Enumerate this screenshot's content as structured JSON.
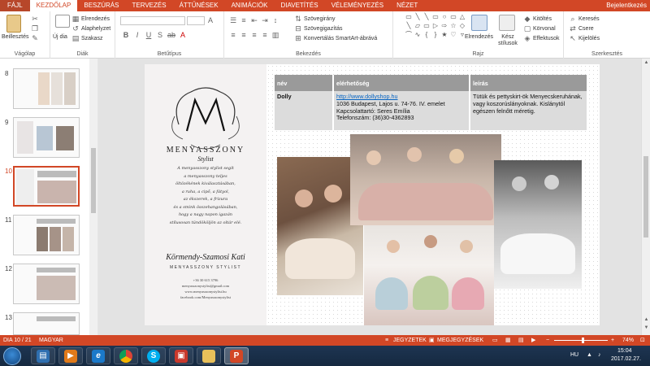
{
  "tabs": [
    "FÁJL",
    "KEZDŐLAP",
    "BESZÚRÁS",
    "TERVEZÉS",
    "ÁTTŰNÉSEK",
    "ANIMÁCIÓK",
    "DIAVETÍTÉS",
    "VÉLEMÉNYEZÉS",
    "NÉZET"
  ],
  "user": "Bejelentkezés",
  "ribbon": {
    "groups": {
      "clipboard": "Vágólap",
      "slides": "Diák",
      "font": "Betűtípus",
      "paragraph": "Bekezdés",
      "drawing": "Rajz",
      "editing": "Szerkesztés"
    },
    "paste": "Beillesztés",
    "new_slide": "Új dia",
    "layout": "Elrendezés",
    "reset": "Alaphelyzet",
    "section": "Szakasz",
    "text_direction": "Szövegirány",
    "align_text": "Szövegigazítás",
    "smartart": "Konvertálás SmartArt-ábrává",
    "arrange": "Elrendezés",
    "quick_styles": "Kész stílusok",
    "fill": "Kitöltés",
    "outline": "Körvonal",
    "effects": "Effektusok",
    "find": "Keresés",
    "replace": "Csere",
    "select": "Kijelölés"
  },
  "thumbnails": [
    {
      "num": "8",
      "selected": false
    },
    {
      "num": "9",
      "selected": false
    },
    {
      "num": "10",
      "selected": true
    },
    {
      "num": "11",
      "selected": false
    },
    {
      "num": "12",
      "selected": false
    },
    {
      "num": "13",
      "selected": false
    }
  ],
  "slide": {
    "logo": "MENYASSZONY",
    "logo_sub": "Stylist",
    "intro": "A menyasszony stylist segít\na menyasszony teljes\nöltözékének kiválasztásában,\na ruha, a cipő, a fátyol,\naz ékszerek, a frizura\nés a smink összehangolásában,\nhogy a nagy napon igazán\nstílusosan tündököljön az oltár elé.",
    "signature": "Körmendy-Szamosi Kati",
    "signature_sub": "MENYASSZONY STYLIST",
    "contact": "+36 30 615 3796\nmenyasszonystylist@gmail.com\nwww.menyasszonystylist.hu\nfacebook.com/Menyasszonystylist",
    "table": {
      "headers": [
        "név",
        "elérhetőség",
        "leírás"
      ],
      "row": {
        "name": "Dolly",
        "link": "http://www.dollyshop.hu",
        "address": "1036 Budapest, Lajos u. 74-76. IV. emelet",
        "contact_person": "Kapcsolattartó: Seres Emília",
        "phone": "Telefonszám: (36)30-4362893",
        "description": "Tütük és pettyskirt-ök Menyecskeruhának, vagy koszorúslányoknak. Kislánytól egészen felnőtt méretig."
      }
    }
  },
  "status": {
    "slide": "DIA 10 / 21",
    "language": "MAGYAR",
    "notes": "JEGYZETEK",
    "comments": "MEGJEGYZÉSEK",
    "zoom": "74%"
  },
  "taskbar": {
    "lang": "HU",
    "time": "15:04",
    "date": "2017.02.27."
  },
  "colors": {
    "accent": "#d24726",
    "table_header": "#9a9a9a",
    "table_row": "#dcdcdc"
  }
}
